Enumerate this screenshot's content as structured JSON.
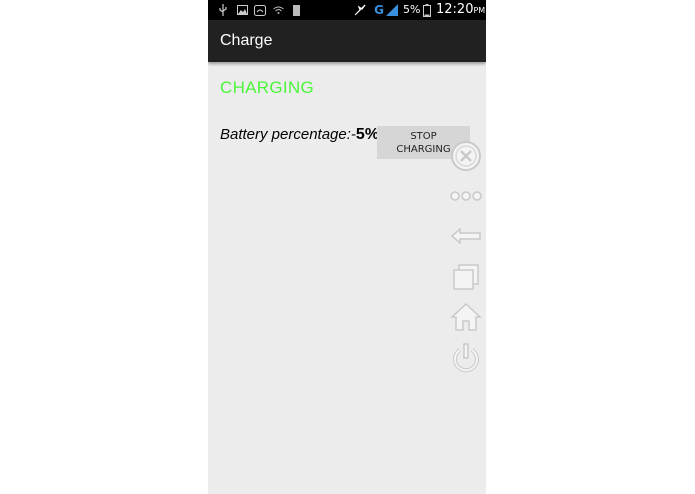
{
  "status_bar": {
    "battery_percent": "5%",
    "time": "12:20",
    "time_suffix": "PM",
    "network_label": "G",
    "icons": [
      "usb-icon",
      "image-icon",
      "wifi-router-icon",
      "wifi-icon",
      "sd-card-icon",
      "mute-icon",
      "signal-icon",
      "battery-icon"
    ]
  },
  "app_bar": {
    "title": "Charge"
  },
  "main": {
    "status_text": "CHARGING",
    "status_color": "#4cf53a",
    "battery_label": "Battery percentage:-",
    "battery_value": "5%",
    "stop_button_label": "STOP CHARGING"
  },
  "floating_toolbar": {
    "icons": [
      "close-circle-icon",
      "more-dots-icon",
      "back-arrow-icon",
      "recent-apps-icon",
      "home-icon",
      "power-icon"
    ]
  }
}
